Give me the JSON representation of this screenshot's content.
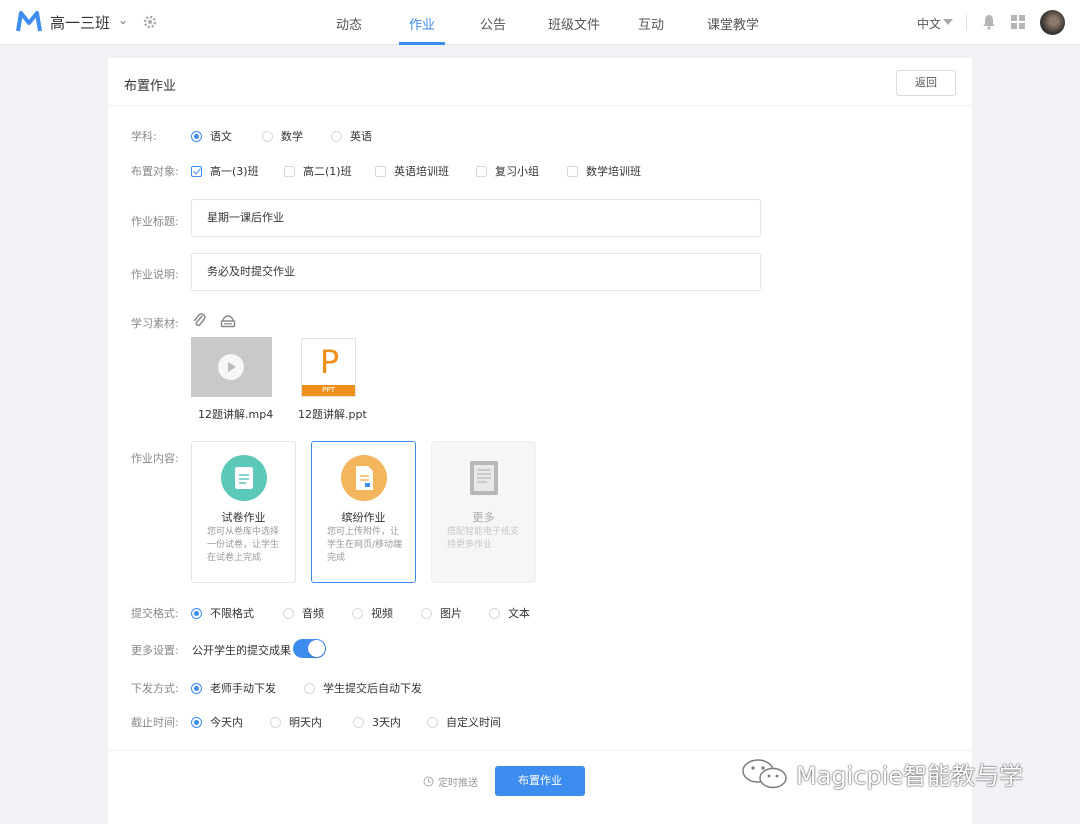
{
  "topbar": {
    "class_name": "高一三班",
    "nav": [
      "动态",
      "作业",
      "公告",
      "班级文件",
      "互动",
      "课堂教学"
    ],
    "active_nav": "作业",
    "language": "中文"
  },
  "page": {
    "title": "布置作业",
    "back_label": "返回"
  },
  "form": {
    "subject": {
      "label": "学科:",
      "options": [
        "语文",
        "数学",
        "英语"
      ],
      "selected": "语文"
    },
    "target": {
      "label": "布置对象:",
      "options": [
        "高一(3)班",
        "高二(1)班",
        "英语培训班",
        "复习小组",
        "数学培训班"
      ],
      "checked": [
        "高一(3)班"
      ]
    },
    "title": {
      "label": "作业标题:",
      "value": "星期一课后作业"
    },
    "description": {
      "label": "作业说明:",
      "value": "务必及时提交作业"
    },
    "materials": {
      "label": "学习素材:",
      "icons": [
        "paperclip-icon",
        "cloud-drive-icon"
      ],
      "files": [
        {
          "name": "12题讲解.mp4",
          "type": "video"
        },
        {
          "name": "12题讲解.ppt",
          "type": "ppt",
          "glyph": "P",
          "band": "PPT"
        }
      ]
    },
    "content": {
      "label": "作业内容:",
      "types": [
        {
          "title": "试卷作业",
          "desc": "您可从卷库中选择一份试卷，让学生在试卷上完成",
          "color": "#5cc8b8",
          "icon": "exam-paper-icon",
          "state": "normal"
        },
        {
          "title": "缤纷作业",
          "desc": "您可上传附件，让学生在网页/移动端完成",
          "color": "#f3b65c",
          "icon": "document-icon",
          "state": "selected"
        },
        {
          "title": "更多",
          "desc": "搭配智能电子纸支持更多作业",
          "color": "#c8c8c8",
          "icon": "e-paper-icon",
          "state": "disabled"
        }
      ]
    },
    "format": {
      "label": "提交格式:",
      "options": [
        "不限格式",
        "音频",
        "视频",
        "图片",
        "文本"
      ],
      "selected": "不限格式"
    },
    "more": {
      "label": "更多设置:",
      "toggle_label": "公开学生的提交成果",
      "on": true
    },
    "dispatch": {
      "label": "下发方式:",
      "options": [
        "老师手动下发",
        "学生提交后自动下发"
      ],
      "selected": "老师手动下发"
    },
    "deadline": {
      "label": "截止时间:",
      "options": [
        "今天内",
        "明天内",
        "3天内",
        "自定义时间"
      ],
      "selected": "今天内"
    }
  },
  "footer": {
    "schedule_label": "定时推送",
    "submit_label": "布置作业"
  },
  "watermark": "Magicpie智能教与学",
  "colors": {
    "accent": "#3d8cf0",
    "orange": "#f0901c",
    "teal": "#5cc8b8"
  }
}
